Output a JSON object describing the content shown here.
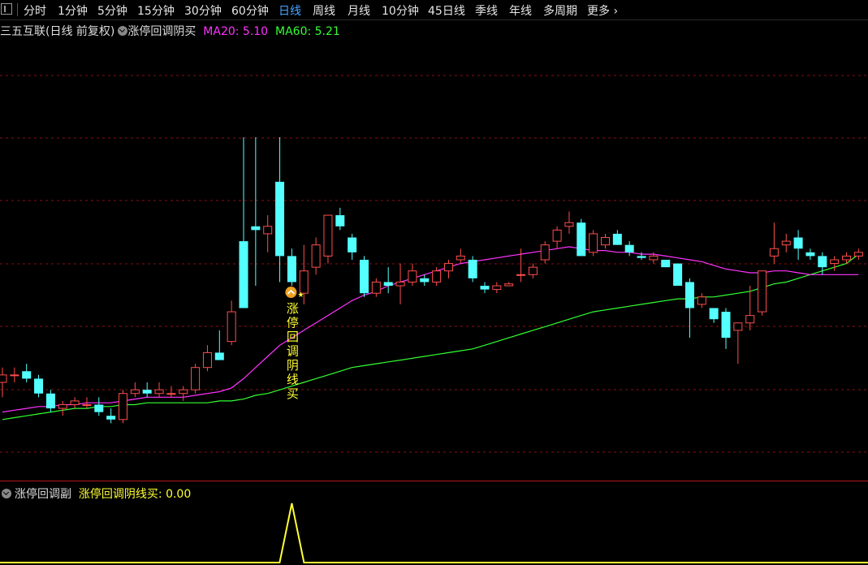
{
  "tabs": {
    "items": [
      "分时",
      "1分钟",
      "5分钟",
      "15分钟",
      "30分钟",
      "60分钟",
      "日线",
      "周线",
      "月线",
      "10分钟",
      "45日线",
      "季线",
      "年线",
      "多周期",
      "更多"
    ],
    "active_index": 6,
    "more_chevron": "›"
  },
  "legend": {
    "stock": "三五互联(日线 前复权)",
    "indicator": "涨停回调阴买",
    "ma20_label": "MA20:",
    "ma20_value": "5.10",
    "ma60_label": "MA60:",
    "ma60_value": "5.21"
  },
  "signal_label": "涨停回调阴线买",
  "sub": {
    "name": "涨停回调副",
    "series_label": "涨停回调阴线买:",
    "value": "0.00"
  },
  "colors": {
    "up": "#ff4d4d",
    "down": "#54ffff",
    "ma20": "#ff33ff",
    "ma60": "#33ff33",
    "signal": "#ffff33",
    "grid": "#8a1010",
    "active_tab": "#4aa3ff"
  },
  "chart_data": {
    "type": "candlestick",
    "x_index_count": 72,
    "ohlc": [
      [
        4.52,
        4.6,
        4.44,
        4.56
      ],
      [
        4.56,
        4.6,
        4.52,
        4.56
      ],
      [
        4.58,
        4.62,
        4.52,
        4.54
      ],
      [
        4.54,
        4.56,
        4.44,
        4.46
      ],
      [
        4.46,
        4.48,
        4.36,
        4.38
      ],
      [
        4.38,
        4.42,
        4.34,
        4.4
      ],
      [
        4.4,
        4.44,
        4.38,
        4.42
      ],
      [
        4.4,
        4.44,
        4.38,
        4.4
      ],
      [
        4.4,
        4.44,
        4.34,
        4.36
      ],
      [
        4.34,
        4.38,
        4.3,
        4.32
      ],
      [
        4.32,
        4.48,
        4.3,
        4.46
      ],
      [
        4.46,
        4.52,
        4.44,
        4.48
      ],
      [
        4.48,
        4.52,
        4.44,
        4.46
      ],
      [
        4.46,
        4.52,
        4.44,
        4.48
      ],
      [
        4.46,
        4.5,
        4.44,
        4.46
      ],
      [
        4.46,
        4.5,
        4.42,
        4.48
      ],
      [
        4.48,
        4.62,
        4.46,
        4.6
      ],
      [
        4.6,
        4.72,
        4.58,
        4.68
      ],
      [
        4.68,
        4.8,
        4.64,
        4.64
      ],
      [
        4.74,
        4.96,
        4.72,
        4.9
      ],
      [
        5.28,
        5.84,
        4.92,
        4.92
      ],
      [
        5.36,
        5.84,
        5.04,
        5.34
      ],
      [
        5.32,
        5.42,
        5.22,
        5.36
      ],
      [
        5.6,
        5.84,
        5.06,
        5.2
      ],
      [
        5.2,
        5.24,
        5.04,
        5.06
      ],
      [
        5.0,
        5.26,
        4.94,
        5.12
      ],
      [
        5.14,
        5.3,
        5.1,
        5.26
      ],
      [
        5.2,
        5.4,
        5.16,
        5.42
      ],
      [
        5.42,
        5.46,
        5.34,
        5.36
      ],
      [
        5.3,
        5.32,
        5.18,
        5.22
      ],
      [
        5.18,
        5.2,
        4.98,
        5.0
      ],
      [
        5.0,
        5.08,
        4.98,
        5.06
      ],
      [
        5.06,
        5.14,
        5.0,
        5.04
      ],
      [
        5.04,
        5.16,
        4.94,
        5.06
      ],
      [
        5.06,
        5.16,
        5.04,
        5.12
      ],
      [
        5.08,
        5.1,
        5.04,
        5.06
      ],
      [
        5.06,
        5.14,
        5.04,
        5.12
      ],
      [
        5.12,
        5.18,
        5.08,
        5.16
      ],
      [
        5.18,
        5.24,
        5.16,
        5.2
      ],
      [
        5.18,
        5.2,
        5.06,
        5.08
      ],
      [
        5.04,
        5.06,
        5.0,
        5.02
      ],
      [
        5.02,
        5.06,
        5.0,
        5.04
      ],
      [
        5.04,
        5.06,
        5.04,
        5.05
      ],
      [
        5.1,
        5.24,
        5.06,
        5.1
      ],
      [
        5.1,
        5.16,
        5.08,
        5.14
      ],
      [
        5.18,
        5.28,
        5.16,
        5.26
      ],
      [
        5.28,
        5.36,
        5.24,
        5.34
      ],
      [
        5.36,
        5.44,
        5.32,
        5.38
      ],
      [
        5.38,
        5.4,
        5.2,
        5.2
      ],
      [
        5.22,
        5.34,
        5.2,
        5.32
      ],
      [
        5.26,
        5.32,
        5.24,
        5.3
      ],
      [
        5.32,
        5.34,
        5.26,
        5.26
      ],
      [
        5.26,
        5.28,
        5.2,
        5.22
      ],
      [
        5.2,
        5.22,
        5.18,
        5.19
      ],
      [
        5.18,
        5.22,
        5.16,
        5.2
      ],
      [
        5.18,
        5.18,
        5.14,
        5.14
      ],
      [
        5.16,
        5.16,
        5.04,
        5.04
      ],
      [
        5.06,
        5.08,
        4.76,
        4.92
      ],
      [
        4.94,
        5.0,
        4.92,
        4.98
      ],
      [
        4.92,
        4.92,
        4.84,
        4.86
      ],
      [
        4.9,
        4.92,
        4.7,
        4.76
      ],
      [
        4.8,
        4.84,
        4.62,
        4.84
      ],
      [
        4.84,
        5.04,
        4.8,
        4.88
      ],
      [
        4.9,
        5.12,
        4.88,
        5.12
      ],
      [
        5.2,
        5.38,
        5.16,
        5.24
      ],
      [
        5.26,
        5.32,
        5.22,
        5.28
      ],
      [
        5.3,
        5.34,
        5.18,
        5.24
      ],
      [
        5.22,
        5.24,
        5.18,
        5.2
      ],
      [
        5.2,
        5.22,
        5.1,
        5.14
      ],
      [
        5.16,
        5.2,
        5.12,
        5.18
      ],
      [
        5.18,
        5.22,
        5.16,
        5.2
      ],
      [
        5.2,
        5.24,
        5.18,
        5.22
      ]
    ],
    "ma20": [
      4.36,
      4.37,
      4.38,
      4.39,
      4.39,
      4.4,
      4.4,
      4.41,
      4.41,
      4.41,
      4.42,
      4.43,
      4.44,
      4.44,
      4.44,
      4.44,
      4.45,
      4.46,
      4.47,
      4.49,
      4.54,
      4.6,
      4.66,
      4.72,
      4.76,
      4.8,
      4.84,
      4.88,
      4.92,
      4.96,
      4.99,
      5.01,
      5.04,
      5.06,
      5.08,
      5.1,
      5.12,
      5.14,
      5.16,
      5.17,
      5.18,
      5.19,
      5.2,
      5.21,
      5.22,
      5.23,
      5.24,
      5.25,
      5.24,
      5.23,
      5.23,
      5.22,
      5.22,
      5.21,
      5.21,
      5.2,
      5.19,
      5.18,
      5.17,
      5.15,
      5.13,
      5.12,
      5.11,
      5.11,
      5.12,
      5.12,
      5.11,
      5.1,
      5.1,
      5.1,
      5.1,
      5.1
    ],
    "ma60": [
      4.32,
      4.33,
      4.34,
      4.35,
      4.36,
      4.37,
      4.38,
      4.38,
      4.39,
      4.39,
      4.4,
      4.4,
      4.41,
      4.41,
      4.41,
      4.41,
      4.41,
      4.41,
      4.42,
      4.42,
      4.43,
      4.45,
      4.46,
      4.48,
      4.5,
      4.52,
      4.54,
      4.56,
      4.58,
      4.6,
      4.61,
      4.62,
      4.63,
      4.64,
      4.65,
      4.66,
      4.67,
      4.68,
      4.69,
      4.7,
      4.72,
      4.74,
      4.76,
      4.78,
      4.8,
      4.82,
      4.84,
      4.86,
      4.88,
      4.9,
      4.91,
      4.92,
      4.93,
      4.94,
      4.95,
      4.96,
      4.97,
      4.97,
      4.98,
      4.98,
      4.99,
      5.0,
      5.01,
      5.03,
      5.05,
      5.06,
      5.08,
      5.1,
      5.12,
      5.14,
      5.16,
      5.21
    ],
    "signal_index": 24,
    "ylim": [
      4.0,
      6.36
    ]
  }
}
